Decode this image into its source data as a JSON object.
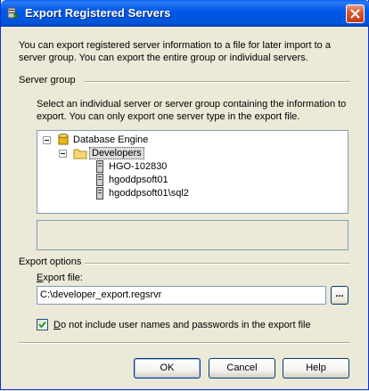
{
  "window": {
    "title": "Export Registered Servers",
    "intro": "You can export registered server information to a file for later import to a server group. You can export the entire group or individual servers."
  },
  "server_group": {
    "label": "Server group",
    "instructions": "Select an individual server or server group containing the information to export. You can only export one server type in the export file.",
    "tree": {
      "root": "Database Engine",
      "folder": "Developers",
      "servers": [
        "HGO-102830",
        "hgoddpsoft01",
        "hgoddpsoft01\\sql2"
      ]
    }
  },
  "export_options": {
    "label": "Export options",
    "file_label_accel": "E",
    "file_label_rest": "xport file:",
    "file_value": "C:\\developer_export.regsrvr",
    "browse_label": "...",
    "checkbox_checked": true,
    "checkbox_accel": "D",
    "checkbox_rest": "o not include user names and passwords in the export file"
  },
  "buttons": {
    "ok": "OK",
    "cancel": "Cancel",
    "help": "Help"
  },
  "icons": {
    "title": "registered-servers-icon",
    "root": "database-icon",
    "folder": "folder-icon",
    "server": "server-icon"
  }
}
